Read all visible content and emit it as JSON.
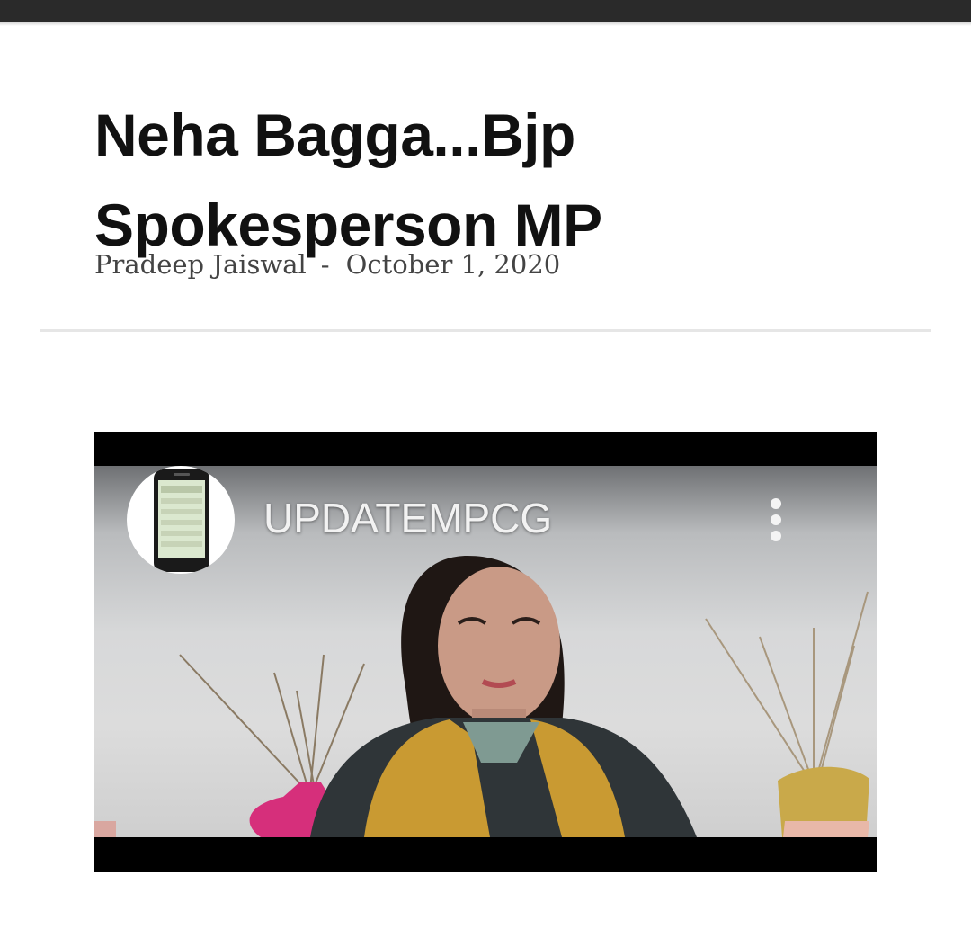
{
  "article": {
    "title": "Neha Bagga...Bjp Spokesperson MP",
    "author": "Pradeep Jaiswal",
    "separator": "-",
    "date": "October 1, 2020"
  },
  "video": {
    "channel_name": "UPDATEMPCG",
    "more_icon": "more-vertical-icon",
    "channel_logo_icon": "phone-icon"
  }
}
